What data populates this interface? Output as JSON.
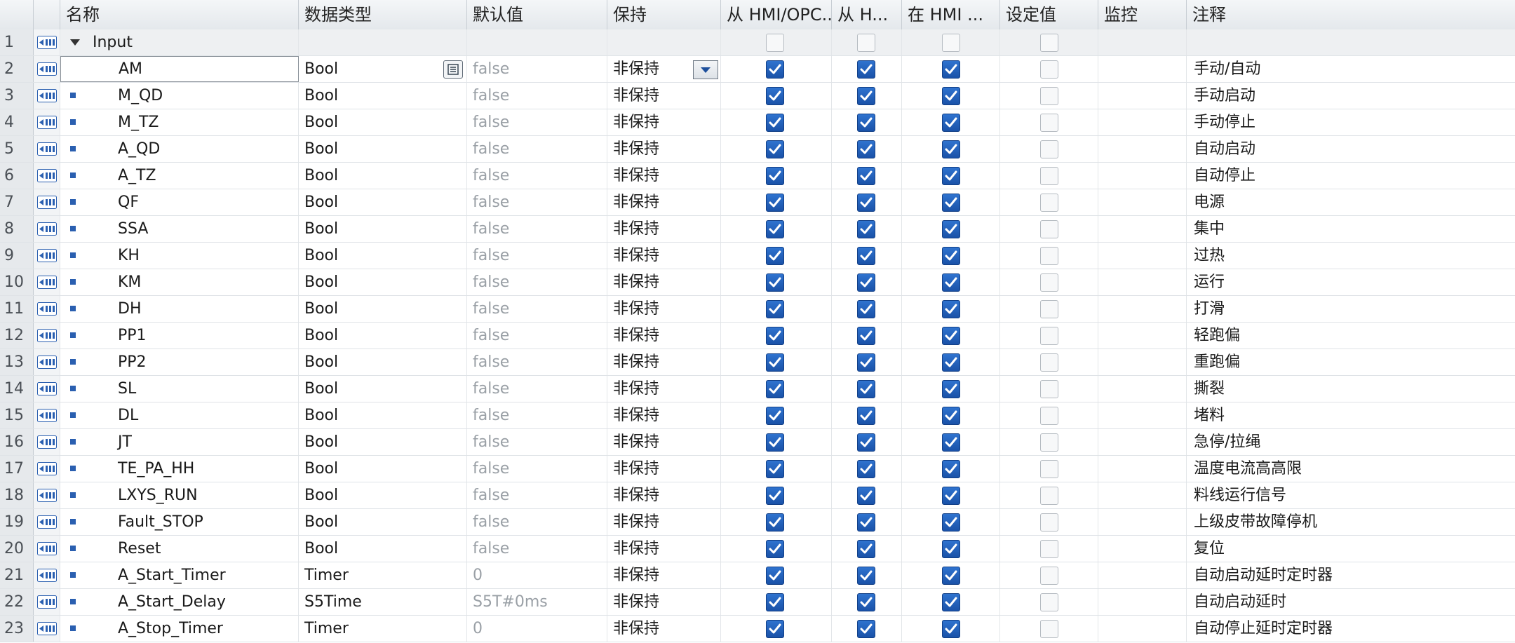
{
  "headers": {
    "name": "名称",
    "datatype": "数据类型",
    "default": "默认值",
    "retain": "保持",
    "hmi_opc": "从 HMI/OPC..",
    "hmi2": "从 H...",
    "in_hmi": "在 HMI ...",
    "setpoint": "设定值",
    "monitor": "监控",
    "comment": "注释"
  },
  "icons": {
    "row_interface": "interface-input-icon",
    "member": "member-square-icon",
    "expand": "triangle-down-icon",
    "picker": "list-picker-icon",
    "dropdown": "dropdown-arrow-icon"
  },
  "colors": {
    "checkbox_on": "#1f5fbf",
    "default_text": "#9aa0a6",
    "header_bg": "#e8ecef"
  },
  "group": {
    "num": "1",
    "name": "Input"
  },
  "rows": [
    {
      "num": "2",
      "name": "AM",
      "type": "Bool",
      "default": "false",
      "retain": "非保持",
      "comment": "手动/自动",
      "selected": true
    },
    {
      "num": "3",
      "name": "M_QD",
      "type": "Bool",
      "default": "false",
      "retain": "非保持",
      "comment": "手动启动"
    },
    {
      "num": "4",
      "name": "M_TZ",
      "type": "Bool",
      "default": "false",
      "retain": "非保持",
      "comment": "手动停止"
    },
    {
      "num": "5",
      "name": "A_QD",
      "type": "Bool",
      "default": "false",
      "retain": "非保持",
      "comment": "自动启动"
    },
    {
      "num": "6",
      "name": "A_TZ",
      "type": "Bool",
      "default": "false",
      "retain": "非保持",
      "comment": "自动停止"
    },
    {
      "num": "7",
      "name": "QF",
      "type": "Bool",
      "default": "false",
      "retain": "非保持",
      "comment": "电源"
    },
    {
      "num": "8",
      "name": "SSA",
      "type": "Bool",
      "default": "false",
      "retain": "非保持",
      "comment": "集中"
    },
    {
      "num": "9",
      "name": "KH",
      "type": "Bool",
      "default": "false",
      "retain": "非保持",
      "comment": "过热"
    },
    {
      "num": "10",
      "name": "KM",
      "type": "Bool",
      "default": "false",
      "retain": "非保持",
      "comment": "运行"
    },
    {
      "num": "11",
      "name": "DH",
      "type": "Bool",
      "default": "false",
      "retain": "非保持",
      "comment": "打滑"
    },
    {
      "num": "12",
      "name": "PP1",
      "type": "Bool",
      "default": "false",
      "retain": "非保持",
      "comment": "轻跑偏"
    },
    {
      "num": "13",
      "name": "PP2",
      "type": "Bool",
      "default": "false",
      "retain": "非保持",
      "comment": "重跑偏"
    },
    {
      "num": "14",
      "name": "SL",
      "type": "Bool",
      "default": "false",
      "retain": "非保持",
      "comment": "撕裂"
    },
    {
      "num": "15",
      "name": "DL",
      "type": "Bool",
      "default": "false",
      "retain": "非保持",
      "comment": "堵料"
    },
    {
      "num": "16",
      "name": "JT",
      "type": "Bool",
      "default": "false",
      "retain": "非保持",
      "comment": "急停/拉绳"
    },
    {
      "num": "17",
      "name": "TE_PA_HH",
      "type": "Bool",
      "default": "false",
      "retain": "非保持",
      "comment": "温度电流高高限"
    },
    {
      "num": "18",
      "name": "LXYS_RUN",
      "type": "Bool",
      "default": "false",
      "retain": "非保持",
      "comment": "料线运行信号"
    },
    {
      "num": "19",
      "name": "Fault_STOP",
      "type": "Bool",
      "default": "false",
      "retain": "非保持",
      "comment": "上级皮带故障停机"
    },
    {
      "num": "20",
      "name": "Reset",
      "type": "Bool",
      "default": "false",
      "retain": "非保持",
      "comment": "复位"
    },
    {
      "num": "21",
      "name": "A_Start_Timer",
      "type": "Timer",
      "default": "0",
      "retain": "非保持",
      "comment": "自动启动延时定时器"
    },
    {
      "num": "22",
      "name": "A_Start_Delay",
      "type": "S5Time",
      "default": "S5T#0ms",
      "retain": "非保持",
      "comment": "自动启动延时"
    },
    {
      "num": "23",
      "name": "A_Stop_Timer",
      "type": "Timer",
      "default": "0",
      "retain": "非保持",
      "comment": "自动停止延时定时器"
    }
  ]
}
